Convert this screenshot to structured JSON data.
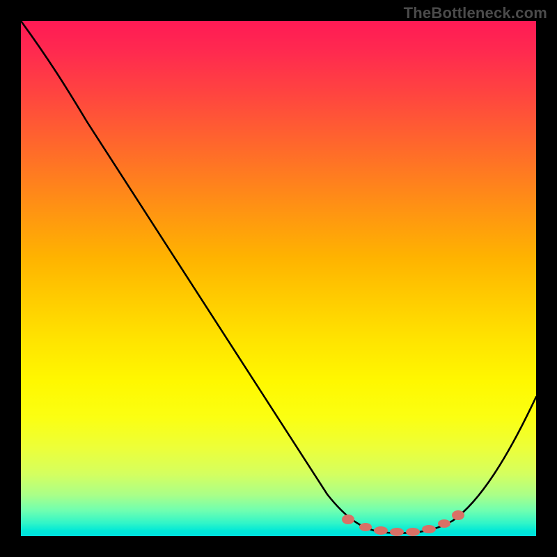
{
  "watermark": "TheBottleneck.com",
  "chart_data": {
    "type": "line",
    "title": "",
    "xlabel": "",
    "ylabel": "",
    "xlim": [
      0,
      100
    ],
    "ylim": [
      0,
      100
    ],
    "grid": false,
    "legend": false,
    "series": [
      {
        "name": "bottleneck-curve",
        "x": [
          0,
          6,
          12,
          18,
          24,
          30,
          36,
          42,
          48,
          54,
          60,
          64,
          68,
          72,
          76,
          80,
          84,
          88,
          92,
          96,
          100
        ],
        "values": [
          100,
          94,
          86,
          77,
          68,
          59,
          50,
          41,
          32,
          23,
          15,
          10,
          6,
          3,
          1,
          1,
          3,
          8,
          15,
          24,
          35
        ]
      }
    ],
    "markers": {
      "name": "optimal-range-markers",
      "x": [
        64,
        67,
        70,
        73,
        76,
        79,
        82,
        85
      ],
      "values": [
        2.2,
        1.5,
        1.0,
        0.8,
        0.8,
        1.0,
        1.6,
        2.6
      ]
    },
    "background_gradient": {
      "top": "#ff1a55",
      "mid": "#fff800",
      "bottom": "#00e0e0"
    }
  }
}
